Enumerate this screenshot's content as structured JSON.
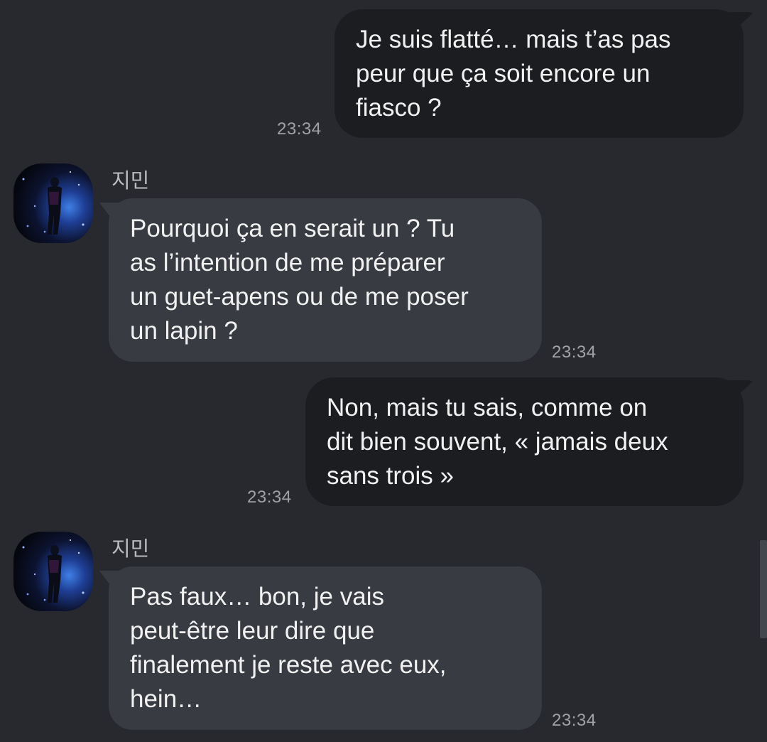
{
  "messages": [
    {
      "direction": "outgoing",
      "lines": [
        "Je suis flatté… mais t’as pas",
        "peur que ça soit encore un",
        "fiasco ?"
      ],
      "time": "23:34"
    },
    {
      "direction": "incoming",
      "sender": "지민",
      "lines": [
        "Pourquoi ça en serait un ? Tu",
        "as l’intention de me préparer",
        "un guet-apens ou de me poser",
        "un lapin ?"
      ],
      "time": "23:34"
    },
    {
      "direction": "outgoing",
      "lines": [
        "Non, mais tu sais, comme on",
        "dit bien souvent, « jamais deux",
        "sans trois »"
      ],
      "time": "23:34"
    },
    {
      "direction": "incoming",
      "sender": "지민",
      "lines": [
        "Pas faux… bon, je vais",
        "peut-être leur dire que",
        "finalement je reste avec eux,",
        "hein…"
      ],
      "time": "23:34"
    }
  ],
  "colors": {
    "background": "#27292e",
    "outgoing_bubble": "#1c1d21",
    "incoming_bubble": "#383b42",
    "text": "#f1f1f1",
    "timestamp": "#9fa1a6"
  },
  "icons": {
    "avatar": "profile-photo"
  }
}
